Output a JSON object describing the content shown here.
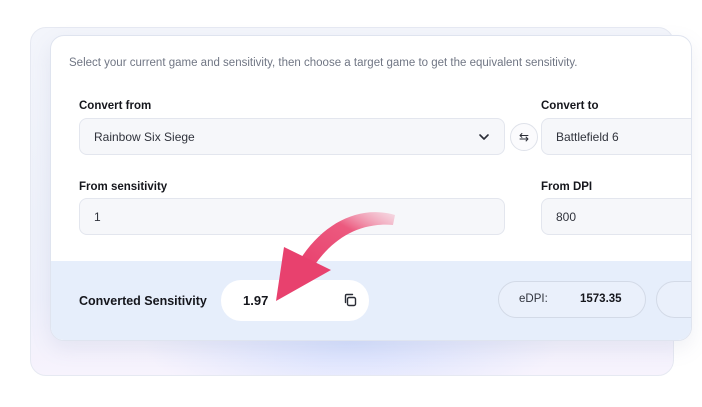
{
  "intro_text": "Select your current game and sensitivity, then choose a target game to get the equivalent sensitivity.",
  "convert_from": {
    "label": "Convert from",
    "value": "Rainbow Six Siege"
  },
  "convert_to": {
    "label": "Convert to",
    "value": "Battlefield 6"
  },
  "swap_icon": "⇆",
  "from_sensitivity": {
    "label": "From sensitivity",
    "value": "1"
  },
  "from_dpi": {
    "label": "From DPI",
    "value": "800"
  },
  "result": {
    "label": "Converted Sensitivity",
    "value": "1.97",
    "copy_icon": "copy-icon"
  },
  "edpi": {
    "label": "eDPI:",
    "value": "1573.35"
  },
  "colors": {
    "accent_arrow": "#e8416e",
    "result_band": "#e6eefb"
  }
}
